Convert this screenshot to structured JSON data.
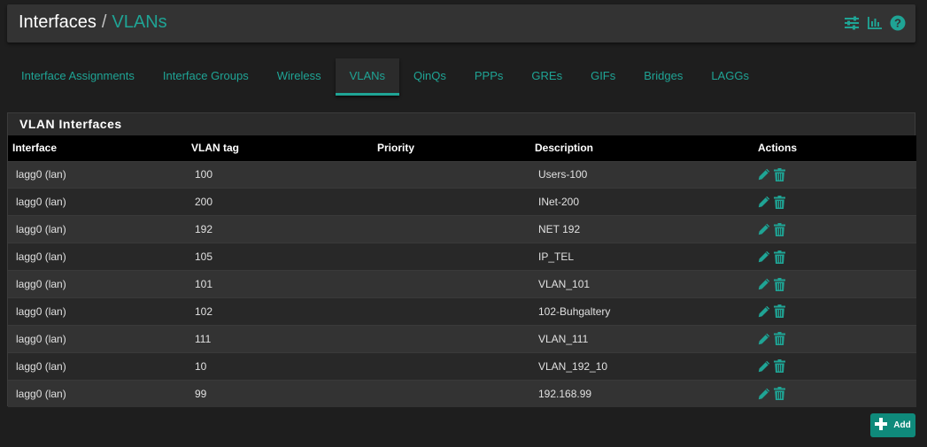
{
  "breadcrumb": {
    "root": "Interfaces",
    "separator": "/",
    "current": "VLANs"
  },
  "header_icons": [
    "sliders-icon",
    "bar-chart-icon",
    "help-icon"
  ],
  "tabs": [
    {
      "label": "Interface Assignments",
      "active": false
    },
    {
      "label": "Interface Groups",
      "active": false
    },
    {
      "label": "Wireless",
      "active": false
    },
    {
      "label": "VLANs",
      "active": true
    },
    {
      "label": "QinQs",
      "active": false
    },
    {
      "label": "PPPs",
      "active": false
    },
    {
      "label": "GREs",
      "active": false
    },
    {
      "label": "GIFs",
      "active": false
    },
    {
      "label": "Bridges",
      "active": false
    },
    {
      "label": "LAGGs",
      "active": false
    }
  ],
  "panel": {
    "title": "VLAN Interfaces",
    "columns": [
      "Interface",
      "VLAN tag",
      "Priority",
      "Description",
      "Actions"
    ],
    "rows": [
      {
        "interface": "lagg0 (lan)",
        "tag": "100",
        "priority": "",
        "description": "Users-100"
      },
      {
        "interface": "lagg0 (lan)",
        "tag": "200",
        "priority": "",
        "description": "INet-200"
      },
      {
        "interface": "lagg0 (lan)",
        "tag": "192",
        "priority": "",
        "description": "NET 192"
      },
      {
        "interface": "lagg0 (lan)",
        "tag": "105",
        "priority": "",
        "description": "IP_TEL"
      },
      {
        "interface": "lagg0 (lan)",
        "tag": "101",
        "priority": "",
        "description": "VLAN_101"
      },
      {
        "interface": "lagg0 (lan)",
        "tag": "102",
        "priority": "",
        "description": "102-Buhgaltery"
      },
      {
        "interface": "lagg0 (lan)",
        "tag": "111",
        "priority": "",
        "description": "VLAN_111"
      },
      {
        "interface": "lagg0 (lan)",
        "tag": "10",
        "priority": "",
        "description": "VLAN_192_10"
      },
      {
        "interface": "lagg0 (lan)",
        "tag": "99",
        "priority": "",
        "description": "192.168.99"
      }
    ]
  },
  "add_button": {
    "label": "Add"
  },
  "colors": {
    "accent": "#1fa495",
    "button": "#0f8a7b",
    "background": "#1e1e1e"
  }
}
